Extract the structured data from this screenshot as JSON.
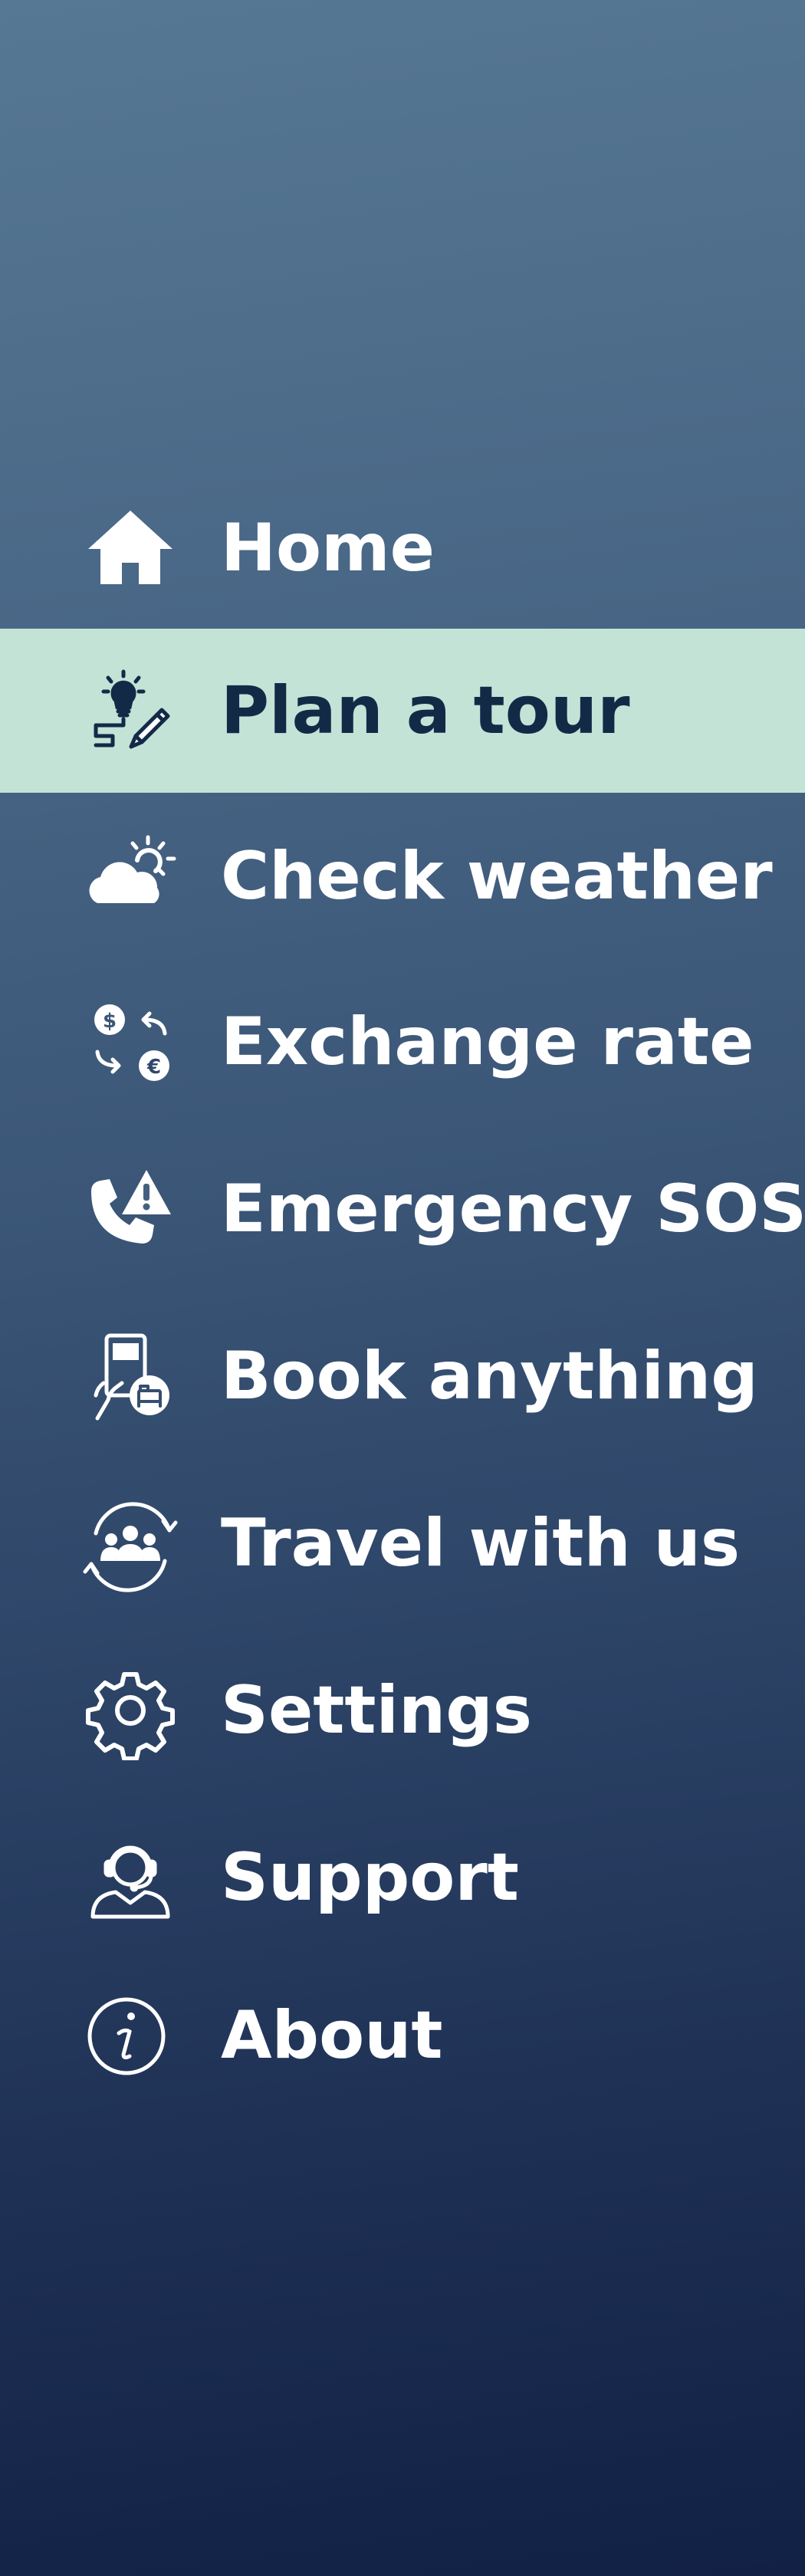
{
  "colors": {
    "background_top": "#567894",
    "background_bottom": "#112045",
    "active_background": "#c4e3d7",
    "active_text": "#132a47",
    "text": "#ffffff"
  },
  "menu": {
    "active_index": 1,
    "items": [
      {
        "label": "Home",
        "icon": "home-icon"
      },
      {
        "label": "Plan a tour",
        "icon": "plan-tour-icon"
      },
      {
        "label": "Check weather",
        "icon": "weather-icon"
      },
      {
        "label": "Exchange rate",
        "icon": "currency-exchange-icon"
      },
      {
        "label": "Emergency SOS",
        "icon": "emergency-phone-icon"
      },
      {
        "label": "Book anything",
        "icon": "booking-phone-icon"
      },
      {
        "label": "Travel with us",
        "icon": "group-travel-icon"
      },
      {
        "label": "Settings",
        "icon": "gear-icon"
      },
      {
        "label": "Support",
        "icon": "support-agent-icon"
      },
      {
        "label": "About",
        "icon": "info-icon"
      }
    ]
  }
}
